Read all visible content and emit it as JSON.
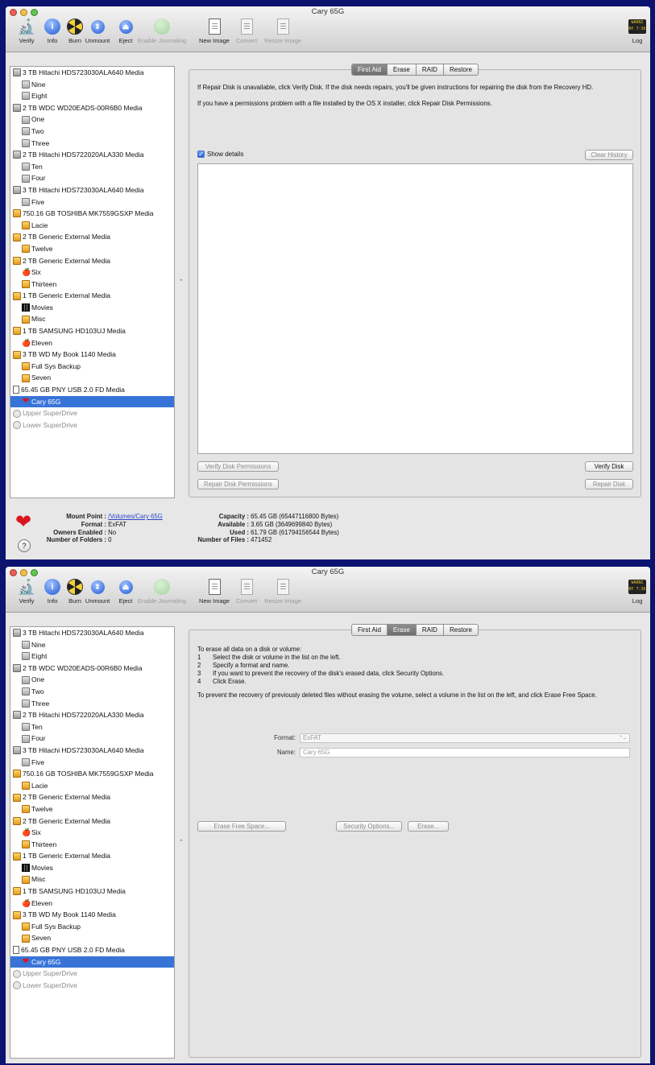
{
  "window_title": "Cary 65G",
  "toolbar": [
    {
      "label": "Verify",
      "icon": "microscope-icon",
      "enabled": true
    },
    {
      "label": "Info",
      "icon": "info-icon",
      "enabled": true
    },
    {
      "label": "Burn",
      "icon": "burn-radiation-icon",
      "enabled": true
    },
    {
      "label": "Unmount",
      "icon": "unmount-icon",
      "enabled": true
    },
    {
      "label": "Eject",
      "icon": "eject-icon",
      "enabled": true
    },
    {
      "label": "Enable Journaling",
      "icon": "journaling-icon",
      "enabled": false
    },
    {
      "label": "New Image",
      "icon": "new-image-icon",
      "enabled": true
    },
    {
      "label": "Convert",
      "icon": "convert-icon",
      "enabled": false
    },
    {
      "label": "Resize Image",
      "icon": "resize-image-icon",
      "enabled": false
    },
    {
      "label": "Log",
      "icon": "log-icon",
      "enabled": true
    }
  ],
  "log_icon_text": "WARNI\nNY 7:36",
  "sidebar_items": [
    {
      "label": "3 TB Hitachi HDS723030ALA640 Media",
      "depth": 0,
      "icon": "disk"
    },
    {
      "label": "Nine",
      "depth": 1,
      "icon": "vol"
    },
    {
      "label": "Eight",
      "depth": 1,
      "icon": "vol"
    },
    {
      "label": "2 TB WDC WD20EADS-00R6B0 Media",
      "depth": 0,
      "icon": "disk"
    },
    {
      "label": "One",
      "depth": 1,
      "icon": "vol"
    },
    {
      "label": "Two",
      "depth": 1,
      "icon": "vol"
    },
    {
      "label": "Three",
      "depth": 1,
      "icon": "vol"
    },
    {
      "label": "2 TB Hitachi HDS722020ALA330 Media",
      "depth": 0,
      "icon": "disk"
    },
    {
      "label": "Ten",
      "depth": 1,
      "icon": "vol"
    },
    {
      "label": "Four",
      "depth": 1,
      "icon": "vol"
    },
    {
      "label": "3 TB Hitachi HDS723030ALA640 Media",
      "depth": 0,
      "icon": "disk"
    },
    {
      "label": "Five",
      "depth": 1,
      "icon": "vol"
    },
    {
      "label": "750.16 GB TOSHIBA MK7559GSXP Media",
      "depth": 0,
      "icon": "ext"
    },
    {
      "label": "Lacie",
      "depth": 1,
      "icon": "ext"
    },
    {
      "label": "2 TB Generic External Media",
      "depth": 0,
      "icon": "ext"
    },
    {
      "label": "Twelve",
      "depth": 1,
      "icon": "ext"
    },
    {
      "label": "2 TB Generic External Media",
      "depth": 0,
      "icon": "ext"
    },
    {
      "label": "Six",
      "depth": 1,
      "icon": "apple"
    },
    {
      "label": "Thirteen",
      "depth": 1,
      "icon": "ext"
    },
    {
      "label": "1 TB Generic External Media",
      "depth": 0,
      "icon": "ext"
    },
    {
      "label": "Movies",
      "depth": 1,
      "icon": "film"
    },
    {
      "label": "Misc",
      "depth": 1,
      "icon": "ext"
    },
    {
      "label": "1 TB SAMSUNG HD103UJ Media",
      "depth": 0,
      "icon": "ext"
    },
    {
      "label": "Eleven",
      "depth": 1,
      "icon": "apple"
    },
    {
      "label": "3 TB WD My Book 1140 Media",
      "depth": 0,
      "icon": "ext"
    },
    {
      "label": "Full Sys Backup",
      "depth": 1,
      "icon": "ext"
    },
    {
      "label": "Seven",
      "depth": 1,
      "icon": "ext"
    },
    {
      "label": "65.45 GB PNY USB 2.0 FD Media",
      "depth": 0,
      "icon": "usb"
    },
    {
      "label": "Cary 65G",
      "depth": 1,
      "icon": "heart",
      "selected": true
    },
    {
      "label": "Upper SuperDrive",
      "depth": 0,
      "icon": "drive",
      "dimmed": true
    },
    {
      "label": "Lower SuperDrive",
      "depth": 0,
      "icon": "drive",
      "dimmed": true
    }
  ],
  "tabs": [
    "First Aid",
    "Erase",
    "RAID",
    "Restore"
  ],
  "first_aid": {
    "line1": "If Repair Disk is unavailable, click Verify Disk. If the disk needs repairs, you'll be given instructions for repairing the disk from the Recovery HD.",
    "line2": "If you have a permissions problem with a file installed by the OS X installer, click Repair Disk Permissions.",
    "show_details": "Show details",
    "show_details_checked": true,
    "clear_history": "Clear History",
    "verify_permissions": "Verify Disk Permissions",
    "repair_permissions": "Repair Disk Permissions",
    "verify_disk": "Verify Disk",
    "repair_disk": "Repair Disk"
  },
  "status": {
    "mount_point_label": "Mount Point :",
    "mount_point": "/Volumes/Cary 65G",
    "format_label": "Format :",
    "format": "ExFAT",
    "owners_label": "Owners Enabled :",
    "owners": "No",
    "folders_label": "Number of Folders :",
    "folders": "0",
    "capacity_label": "Capacity :",
    "capacity": "65.45 GB (65447116800 Bytes)",
    "available_label": "Available :",
    "available": "3.65 GB (3649699840 Bytes)",
    "used_label": "Used :",
    "used": "61.79 GB (61794156544 Bytes)",
    "files_label": "Number of Files :",
    "files": "471452",
    "help": "?"
  },
  "erase": {
    "intro": "To erase all data on a disk or volume:",
    "steps": [
      {
        "n": "1",
        "text": "Select the disk or volume in the list on the left."
      },
      {
        "n": "2",
        "text": "Specify a format and name."
      },
      {
        "n": "3",
        "text": "If you want to prevent the recovery of the disk's erased data, click Security Options."
      },
      {
        "n": "4",
        "text": "Click Erase."
      }
    ],
    "free_space_note": "To prevent the recovery of previously deleted files without erasing the volume, select a volume in the list on the left, and click Erase Free Space.",
    "format_label": "Format:",
    "format_value": "ExFAT",
    "name_label": "Name:",
    "name_value": "Cary 65G",
    "erase_free_space": "Erase Free Space...",
    "security_options": "Security Options...",
    "erase_button": "Erase..."
  },
  "colors": {
    "desktop": "#0c1470",
    "selection": "#3874d8",
    "heart": "#d8141c"
  }
}
